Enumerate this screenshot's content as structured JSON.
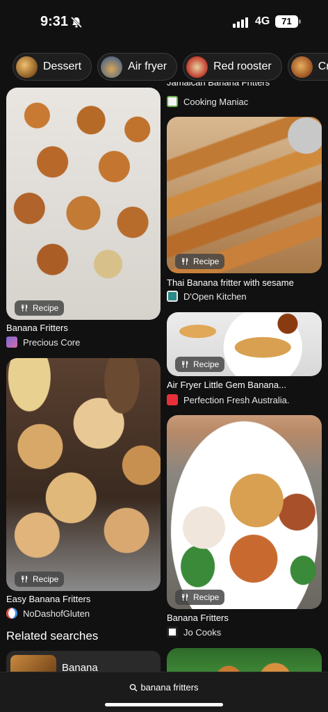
{
  "status": {
    "time": "9:31",
    "network": "4G",
    "battery": "71"
  },
  "chips": [
    {
      "label": "Dessert",
      "icon": "dessert-thumb"
    },
    {
      "label": "Air fryer",
      "icon": "air-fryer-thumb"
    },
    {
      "label": "Red rooster",
      "icon": "red-rooster-thumb"
    },
    {
      "label": "Cri",
      "icon": "cri-thumb"
    }
  ],
  "left_column": [
    {
      "title": "Banana Fritters",
      "source": "Precious Core",
      "badge": "Recipe"
    },
    {
      "title": "Easy Banana Fritters",
      "source": "NoDashofGluten",
      "badge": "Recipe"
    }
  ],
  "right_column": [
    {
      "title": "Jamaican Banana Fritters",
      "source": "Cooking Maniac"
    },
    {
      "title": "Thai Banana fritter with sesame",
      "source": "D'Open Kitchen",
      "badge": "Recipe"
    },
    {
      "title": "Air Fryer Little Gem Banana...",
      "source": "Perfection Fresh Australia.",
      "badge": "Recipe"
    },
    {
      "title": "Banana Fritters",
      "source": "Jo Cooks",
      "badge": "Recipe"
    }
  ],
  "related": {
    "heading": "Related searches",
    "first_item": "Banana"
  },
  "search": {
    "query": "banana fritters"
  },
  "colors": {
    "background": "#111111",
    "text": "#ffffff",
    "chip_border": "#3c3c3c"
  }
}
